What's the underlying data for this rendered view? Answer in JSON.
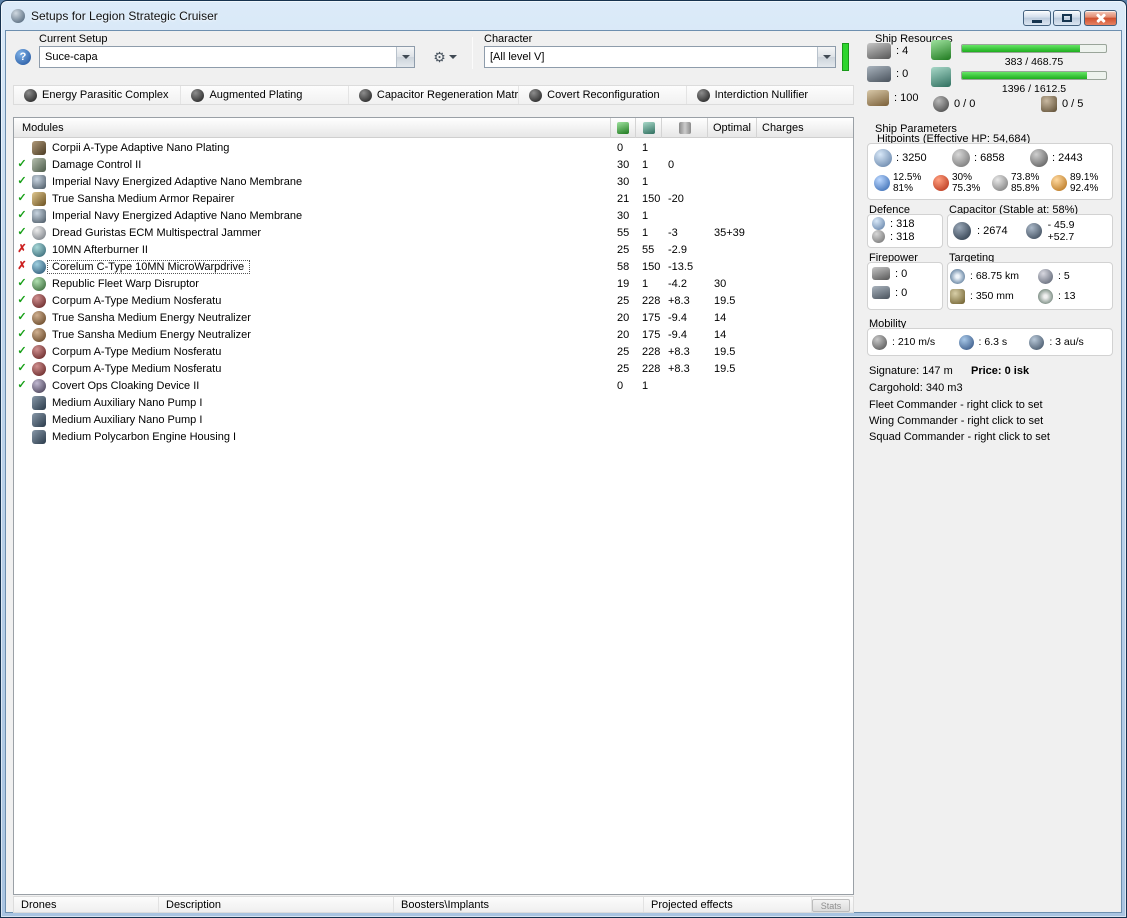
{
  "colors": {
    "accent_green": "#2ed52e",
    "check_green": "#18a018",
    "offline_red": "#cc1f1f",
    "bar_green": "#2fc82f",
    "titlebar_blue": "#c3d8ee"
  },
  "window": {
    "title": "Setups for Legion Strategic Cruiser"
  },
  "toolbar": {
    "current_setup_label": "Current Setup",
    "setup_value": "Suce-capa",
    "character_label": "Character",
    "character_value": "[All level V]"
  },
  "subsystems": [
    "Energy Parasitic Complex",
    "Augmented Plating",
    "Capacitor Regeneration Matr",
    "Covert Reconfiguration",
    "Interdiction Nullifier"
  ],
  "modules": {
    "header": {
      "name": "Modules",
      "optimal": "Optimal",
      "charges": "Charges"
    },
    "rows": [
      {
        "status": "none",
        "icon": "armor-plating-icon",
        "name": "Corpii A-Type Adaptive Nano Plating",
        "cpu": "0",
        "pg": "1",
        "cap": "",
        "optimal": "",
        "charges": ""
      },
      {
        "status": "ok",
        "icon": "damage-control-icon",
        "name": "Damage Control II",
        "cpu": "30",
        "pg": "1",
        "cap": "0",
        "optimal": "",
        "charges": ""
      },
      {
        "status": "ok",
        "icon": "armor-membrane-icon",
        "name": "Imperial Navy Energized Adaptive Nano Membrane",
        "cpu": "30",
        "pg": "1",
        "cap": "",
        "optimal": "",
        "charges": ""
      },
      {
        "status": "ok",
        "icon": "armor-repairer-icon",
        "name": "True Sansha Medium Armor Repairer",
        "cpu": "21",
        "pg": "150",
        "cap": "-20",
        "optimal": "",
        "charges": ""
      },
      {
        "status": "ok",
        "icon": "armor-membrane-icon",
        "name": "Imperial Navy Energized Adaptive Nano Membrane",
        "cpu": "30",
        "pg": "1",
        "cap": "",
        "optimal": "",
        "charges": ""
      },
      {
        "status": "ok",
        "icon": "ecm-jammer-icon",
        "name": "Dread Guristas ECM Multispectral Jammer",
        "cpu": "55",
        "pg": "1",
        "cap": "-3",
        "optimal": "35+39",
        "charges": ""
      },
      {
        "status": "off",
        "icon": "afterburner-icon",
        "name": "10MN Afterburner II",
        "cpu": "25",
        "pg": "55",
        "cap": "-2.9",
        "optimal": "",
        "charges": ""
      },
      {
        "status": "off",
        "icon": "microwarpdrive-icon",
        "name": "Corelum C-Type 10MN MicroWarpdrive",
        "cpu": "58",
        "pg": "150",
        "cap": "-13.5",
        "optimal": "",
        "charges": "",
        "selected": true
      },
      {
        "status": "ok",
        "icon": "warp-disruptor-icon",
        "name": "Republic Fleet Warp Disruptor",
        "cpu": "19",
        "pg": "1",
        "cap": "-4.2",
        "optimal": "30",
        "charges": ""
      },
      {
        "status": "ok",
        "icon": "nosferatu-icon",
        "name": "Corpum A-Type Medium Nosferatu",
        "cpu": "25",
        "pg": "228",
        "cap": "+8.3",
        "optimal": "19.5",
        "charges": ""
      },
      {
        "status": "ok",
        "icon": "neutralizer-icon",
        "name": "True Sansha Medium Energy Neutralizer",
        "cpu": "20",
        "pg": "175",
        "cap": "-9.4",
        "optimal": "14",
        "charges": ""
      },
      {
        "status": "ok",
        "icon": "neutralizer-icon",
        "name": "True Sansha Medium Energy Neutralizer",
        "cpu": "20",
        "pg": "175",
        "cap": "-9.4",
        "optimal": "14",
        "charges": ""
      },
      {
        "status": "ok",
        "icon": "nosferatu-icon",
        "name": "Corpum A-Type Medium Nosferatu",
        "cpu": "25",
        "pg": "228",
        "cap": "+8.3",
        "optimal": "19.5",
        "charges": ""
      },
      {
        "status": "ok",
        "icon": "nosferatu-icon",
        "name": "Corpum A-Type Medium Nosferatu",
        "cpu": "25",
        "pg": "228",
        "cap": "+8.3",
        "optimal": "19.5",
        "charges": ""
      },
      {
        "status": "ok",
        "icon": "cloaking-device-icon",
        "name": "Covert Ops Cloaking Device II",
        "cpu": "0",
        "pg": "1",
        "cap": "",
        "optimal": "",
        "charges": ""
      },
      {
        "status": "none",
        "icon": "rig-icon",
        "name": "Medium Auxiliary Nano Pump I",
        "cpu": "",
        "pg": "",
        "cap": "",
        "optimal": "",
        "charges": ""
      },
      {
        "status": "none",
        "icon": "rig-icon",
        "name": "Medium Auxiliary Nano Pump I",
        "cpu": "",
        "pg": "",
        "cap": "",
        "optimal": "",
        "charges": ""
      },
      {
        "status": "none",
        "icon": "rig-icon",
        "name": "Medium Polycarbon Engine Housing I",
        "cpu": "",
        "pg": "",
        "cap": "",
        "optimal": "",
        "charges": ""
      }
    ]
  },
  "footer": {
    "tabs": [
      "Drones",
      "Description",
      "Boosters\\Implants",
      "Projected effects"
    ],
    "stats_button": "Stats"
  },
  "ship_resources": {
    "title": "Ship Resources",
    "turret_hardpoints": ": 4",
    "launcher_hardpoints": ": 0",
    "calibration": ": 100",
    "cpu_text": "383 / 468.75",
    "cpu_pct": 82,
    "powergrid_text": "1396 / 1612.5",
    "powergrid_pct": 87,
    "drones_text": "0 / 0",
    "slots_text": "0 / 5"
  },
  "ship_parameters": {
    "title": "Ship Parameters",
    "hitpoints_label": "Hitpoints (Effective HP: 54,684)",
    "shield_hp": ": 3250",
    "armor_hp": ": 6858",
    "hull_hp": ": 2443",
    "resists": [
      {
        "top": "12.5%",
        "bottom": "81%"
      },
      {
        "top": "30%",
        "bottom": "75.3%"
      },
      {
        "top": "73.8%",
        "bottom": "85.8%"
      },
      {
        "top": "89.1%",
        "bottom": "92.4%"
      }
    ],
    "defence_label": "Defence",
    "defence_value_1": ": 318",
    "defence_value_2": ": 318",
    "capacitor_label": "Capacitor (Stable at: 58%)",
    "capacitor_capacity": ": 2674",
    "capacitor_drain": "- 45.9",
    "capacitor_recharge": "+52.7",
    "firepower_label": "Firepower",
    "turret_dps": ": 0",
    "missile_dps": ": 0",
    "targeting_label": "Targeting",
    "targeting_range": ": 68.75 km",
    "max_targets": ": 5",
    "scan_resolution": ": 350 mm",
    "sensor_strength": ": 13",
    "mobility_label": "Mobility",
    "max_velocity": ": 210 m/s",
    "align_time": ": 6.3 s",
    "warp_speed": ": 3 au/s",
    "signature": "Signature: 147 m",
    "price": "Price: 0 isk",
    "cargohold": "Cargohold: 340 m3",
    "fleet_commander": "Fleet Commander - right click to set",
    "wing_commander": "Wing Commander - right click to set",
    "squad_commander": "Squad Commander - right click to set"
  }
}
